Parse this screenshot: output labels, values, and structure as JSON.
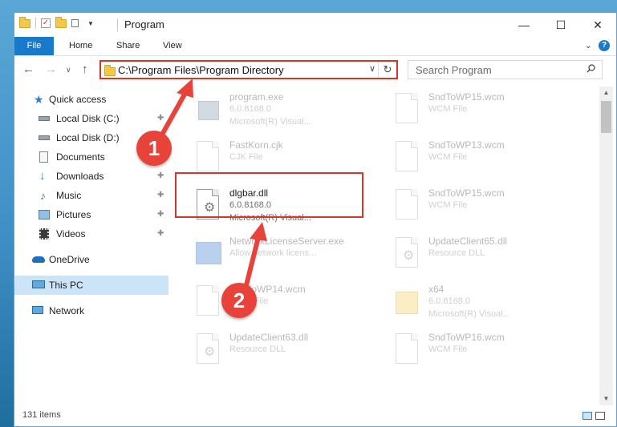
{
  "window": {
    "title": "Program",
    "colors": {
      "accent": "#1979ca",
      "highlight_red": "#d9342b",
      "callout_red": "#e8433a"
    }
  },
  "ribbon": {
    "tabs": [
      {
        "label": "File"
      },
      {
        "label": "Home"
      },
      {
        "label": "Share"
      },
      {
        "label": "View"
      }
    ],
    "help": "?"
  },
  "navigation": {
    "address_path": "C:\\Program Files\\Program Directory",
    "search_placeholder": "Search Program"
  },
  "sidebar": {
    "items": [
      {
        "label": "Quick access",
        "icon": "star-icon"
      },
      {
        "label": "Local Disk (C:)",
        "icon": "drive-icon",
        "pinned": true
      },
      {
        "label": "Local Disk (D:)",
        "icon": "drive-icon"
      },
      {
        "label": "Documents",
        "icon": "documents-icon"
      },
      {
        "label": "Downloads",
        "icon": "download-icon",
        "pinned": true
      },
      {
        "label": "Music",
        "icon": "music-icon",
        "pinned": true
      },
      {
        "label": "Pictures",
        "icon": "pictures-icon",
        "pinned": true
      },
      {
        "label": "Videos",
        "icon": "videos-icon",
        "pinned": true
      },
      {
        "label": "OneDrive",
        "icon": "cloud-icon"
      },
      {
        "label": "This PC",
        "icon": "computer-icon",
        "selected": true
      },
      {
        "label": "Network",
        "icon": "network-icon"
      }
    ]
  },
  "files": [
    {
      "name": "program.exe",
      "line1": "6.0.8168.0",
      "line2": "Microsoft(R) Visual...",
      "icon": "program-exe-icon",
      "faded": true
    },
    {
      "name": "SndToWP15.wcm",
      "line1": "WCM File",
      "line2": "",
      "icon": "document-icon",
      "faded": true
    },
    {
      "name": "FastKorn.cjk",
      "line1": "CJK File",
      "line2": "",
      "icon": "document-icon",
      "faded": true
    },
    {
      "name": "SndToWP13.wcm",
      "line1": "WCM File",
      "line2": "",
      "icon": "document-icon",
      "faded": true
    },
    {
      "name": "dlgbar.dll",
      "line1": "6.0.8168.0",
      "line2": "Microsoft(R) Visual...",
      "icon": "dll-gear-icon",
      "faded": false
    },
    {
      "name": "SndToWP15.wcm",
      "line1": "WCM File",
      "line2": "",
      "icon": "document-icon",
      "faded": true
    },
    {
      "name": "NetworkLicenseServer.exe",
      "line1": "Allow network licens...",
      "line2": "",
      "icon": "exe-window-icon",
      "faded": true
    },
    {
      "name": "UpdateClient65.dll",
      "line1": "Resource DLL",
      "line2": "",
      "icon": "dll-gear-icon",
      "faded": true
    },
    {
      "name": "SndToWP14.wcm",
      "line1": "WCM File",
      "line2": "",
      "icon": "document-icon",
      "faded": true
    },
    {
      "name": "x64",
      "line1": "6.0.8168.0",
      "line2": "Microsoft(R) Visual...",
      "icon": "folder-icon",
      "faded": true
    },
    {
      "name": "UpdateClient63.dll",
      "line1": "Resource DLL",
      "line2": "",
      "icon": "dll-gear-icon",
      "faded": true
    },
    {
      "name": "SndToWP16.wcm",
      "line1": "WCM File",
      "line2": "",
      "icon": "document-icon",
      "faded": true
    }
  ],
  "status": {
    "item_count": "131 items"
  },
  "callouts": [
    {
      "label": "1"
    },
    {
      "label": "2"
    }
  ]
}
